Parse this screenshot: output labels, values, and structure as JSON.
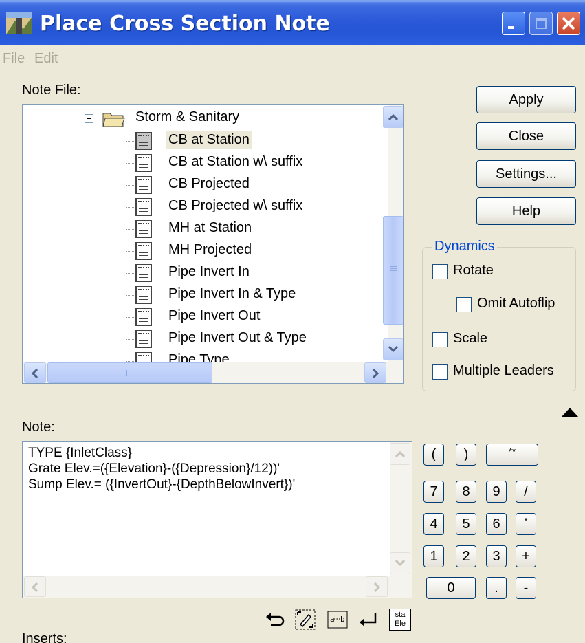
{
  "window": {
    "title": "Place Cross Section Note",
    "title_color": "#2556d5"
  },
  "menu": [
    "File",
    "Edit"
  ],
  "note_file_label": "Note File:",
  "tree": {
    "folder": "Storm & Sanitary",
    "items": [
      "CB at Station",
      "CB at Station w\\ suffix",
      "CB Projected",
      "CB Projected w\\ suffix",
      "MH at Station",
      "MH Projected",
      "Pipe Invert In",
      "Pipe Invert In & Type",
      "Pipe Invert Out",
      "Pipe Invert Out & Type",
      "Pipe Type"
    ],
    "selected_index": 0
  },
  "buttons": {
    "apply": "Apply",
    "close": "Close",
    "settings": "Settings...",
    "help": "Help"
  },
  "dynamics": {
    "title": "Dynamics",
    "rotate": "Rotate",
    "omit_autoflip": "Omit Autoflip",
    "scale": "Scale",
    "multiple_leaders": "Multiple Leaders"
  },
  "note_label": "Note:",
  "note_lines": [
    "TYPE {InletClass}",
    "Grate Elev.=({Elevation}-({Depression}/12))'",
    "Sump Elev.= ({InvertOut}-{DepthBelowInvert})'"
  ],
  "keypad": {
    "row1": [
      "(",
      ")",
      "**"
    ],
    "row2": [
      "7",
      "8",
      "9",
      "/"
    ],
    "row3": [
      "4",
      "5",
      "6",
      "*"
    ],
    "row4": [
      "1",
      "2",
      "3",
      "+"
    ],
    "row5": [
      "0",
      ".",
      "-"
    ]
  },
  "toolbar": {
    "undo_icon": "undo-icon",
    "sta_label_top": "sta",
    "sta_label_bottom": "Ele"
  },
  "inserts_label": "Inserts:"
}
